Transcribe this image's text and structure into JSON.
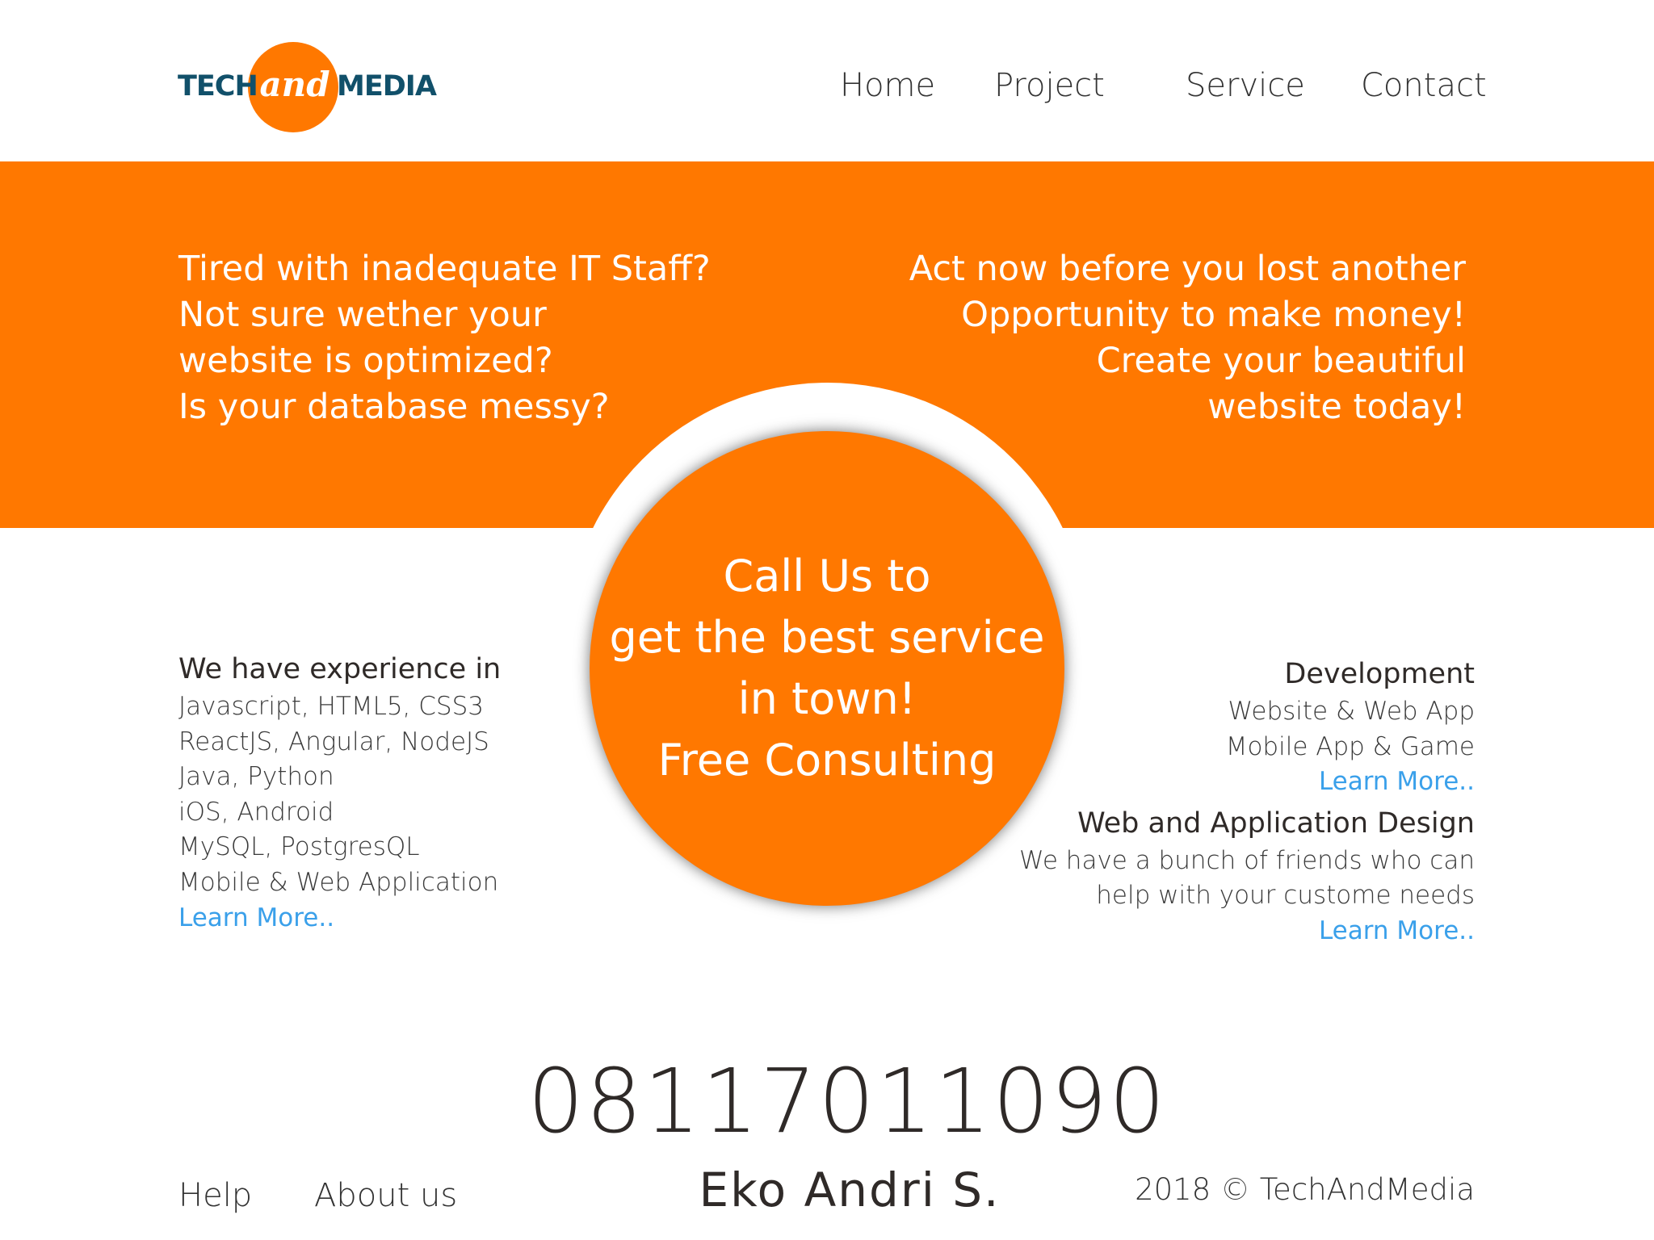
{
  "brand": {
    "logo_left": "TECH",
    "logo_middle": "and",
    "logo_right": "MEDIA",
    "accent_color": "#ff7800",
    "logo_text_color": "#11506a"
  },
  "nav": {
    "items": [
      "Home",
      "Project",
      "Service",
      "Contact"
    ]
  },
  "hero": {
    "left_lines": [
      "Tired with inadequate IT Staff?",
      "Not sure wether your",
      "website is optimized?",
      "Is your database messy?"
    ],
    "right_lines": [
      "Act now before you lost another",
      "Opportunity to make money!",
      "Create your beautiful",
      "website today!"
    ]
  },
  "cta": {
    "lines": [
      "Call Us to",
      "get the best service",
      "in town!",
      "Free Consulting"
    ]
  },
  "experience": {
    "title": "We have experience in",
    "items": [
      "Javascript, HTML5, CSS3",
      "ReactJS, Angular, NodeJS",
      "Java, Python",
      "iOS, Android",
      "MySQL, PostgresQL",
      "Mobile & Web Application"
    ],
    "learn_more": "Learn More.."
  },
  "services": {
    "development": {
      "title": "Development",
      "items": [
        "Website & Web App",
        "Mobile App & Game"
      ],
      "learn_more": "Learn More.."
    },
    "design": {
      "title": "Web and Application Design",
      "items": [
        "We have a bunch of friends who can",
        "help with your custome needs"
      ],
      "learn_more": "Learn More.."
    },
    "link_color": "#3aa0ea"
  },
  "contact": {
    "phone": "08117011090",
    "name": "Eko Andri S."
  },
  "footer": {
    "help": "Help",
    "about": "About us",
    "copyright": "2018 © TechAndMedia"
  }
}
